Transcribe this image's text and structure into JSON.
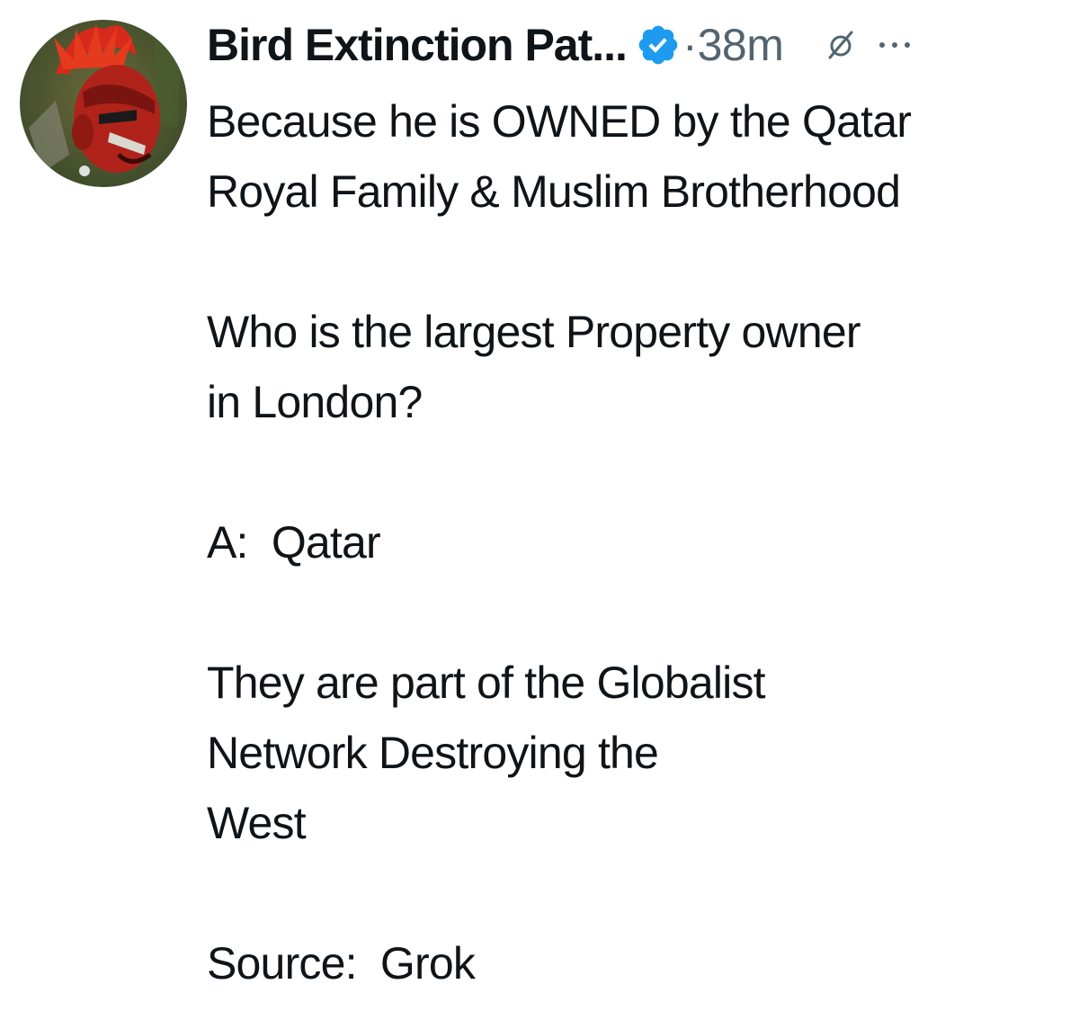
{
  "post": {
    "author_name": "Bird Extinction Pat...",
    "separator": "·",
    "timestamp": "38m",
    "lines": [
      "Because he is OWNED by the Qatar",
      "Royal Family & Muslim Brotherhood",
      "",
      "Who is the largest Property owner",
      "in London?",
      "",
      "A:  Qatar",
      "",
      "They are part of the Globalist",
      "Network Destroying the",
      "West",
      "",
      "Source:  Grok"
    ]
  },
  "icons": {
    "verified": "verified-badge-icon",
    "grok": "grok-icon",
    "more": "more-options-icon"
  },
  "colors": {
    "text": "#0f1419",
    "secondary": "#536471",
    "verified": "#1d9bf0",
    "background": "#ffffff"
  }
}
